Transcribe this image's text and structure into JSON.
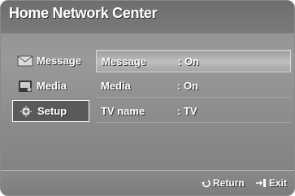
{
  "window": {
    "title": "Home Network Center"
  },
  "sidebar": {
    "items": [
      {
        "label": "Message",
        "icon": "envelope-icon",
        "selected": false
      },
      {
        "label": "Media",
        "icon": "media-icon",
        "selected": false
      },
      {
        "label": "Setup",
        "icon": "gear-icon",
        "selected": true
      }
    ]
  },
  "settings": {
    "rows": [
      {
        "label": "Message",
        "value": ": On"
      },
      {
        "label": "Media",
        "value": ": On"
      },
      {
        "label": "TV name",
        "value": ": TV"
      }
    ]
  },
  "footer": {
    "return_label": "Return",
    "return_icon": "return-arrow-icon",
    "exit_label": "Exit",
    "exit_icon": "exit-icon"
  }
}
